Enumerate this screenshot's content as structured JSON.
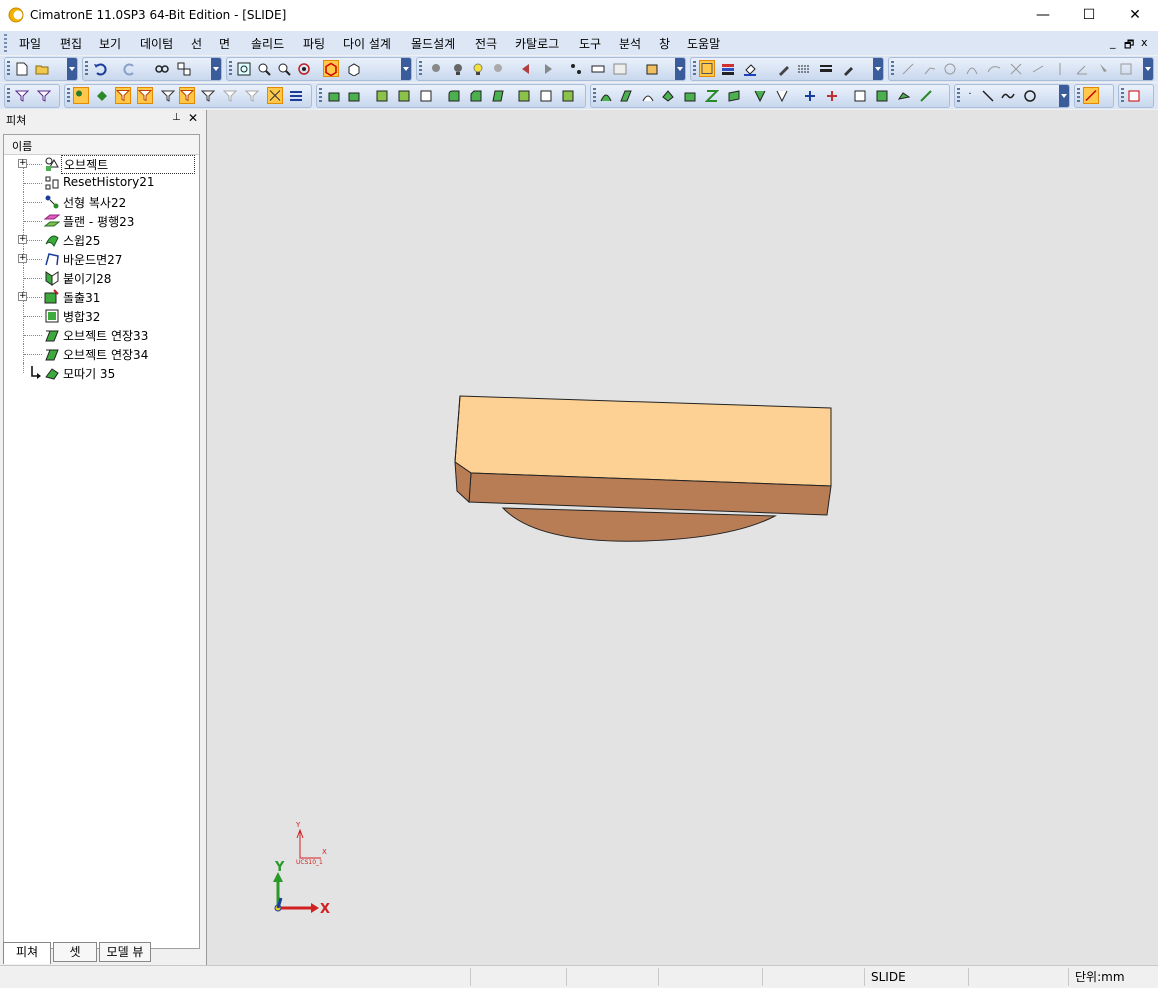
{
  "window": {
    "title": "CimatronE 11.0SP3 64-Bit Edition - [SLIDE]",
    "minimize": "—",
    "maximize": "☐",
    "close": "✕",
    "mdi_controls": [
      "_",
      "🗗",
      "x"
    ]
  },
  "menu": [
    "파일",
    "편집",
    "보기",
    "데이텀",
    "선",
    "면",
    "솔리드",
    "파팅",
    "다이 설계",
    "몰드설계",
    "전극",
    "카탈로그",
    "도구",
    "분석",
    "창",
    "도움말"
  ],
  "feature_panel": {
    "title": "피쳐",
    "pin_icon": "⊥",
    "close_icon": "✕",
    "column_header": "이름",
    "items": [
      {
        "label": "오브젝트",
        "icon": "object-group-icon",
        "expandable": true
      },
      {
        "label": "ResetHistory21",
        "icon": "reset-history-icon",
        "expandable": false
      },
      {
        "label": "선형 복사22",
        "icon": "linear-copy-icon",
        "expandable": false
      },
      {
        "label": "플랜 - 평행23",
        "icon": "plane-parallel-icon",
        "expandable": false
      },
      {
        "label": "스윕25",
        "icon": "sweep-icon",
        "expandable": true
      },
      {
        "label": "바운드면27",
        "icon": "bound-face-icon",
        "expandable": true
      },
      {
        "label": "붙이기28",
        "icon": "attach-icon",
        "expandable": false
      },
      {
        "label": "돌출31",
        "icon": "extrude-icon",
        "expandable": true
      },
      {
        "label": "병합32",
        "icon": "merge-icon",
        "expandable": false
      },
      {
        "label": "오브젝트 연장33",
        "icon": "extend-object-icon",
        "expandable": false
      },
      {
        "label": "오브젝트 연장34",
        "icon": "extend-object-icon",
        "expandable": false
      },
      {
        "label": "모따기  35",
        "icon": "chamfer-icon",
        "expandable": false
      }
    ],
    "tabs": [
      "피쳐",
      "셋",
      "모델 뷰"
    ]
  },
  "viewport": {
    "background": "#e3e3e3",
    "ucs_label": "UCS10_1",
    "small_axis_x": "X",
    "small_axis_y": "Y",
    "axis_x": "X",
    "axis_y": "Y",
    "part_top_color": "#fdd194",
    "part_side_color": "#b97d56"
  },
  "status": {
    "segments": [
      "",
      "",
      "",
      "",
      "",
      "SLIDE",
      "",
      "단위:mm"
    ]
  }
}
